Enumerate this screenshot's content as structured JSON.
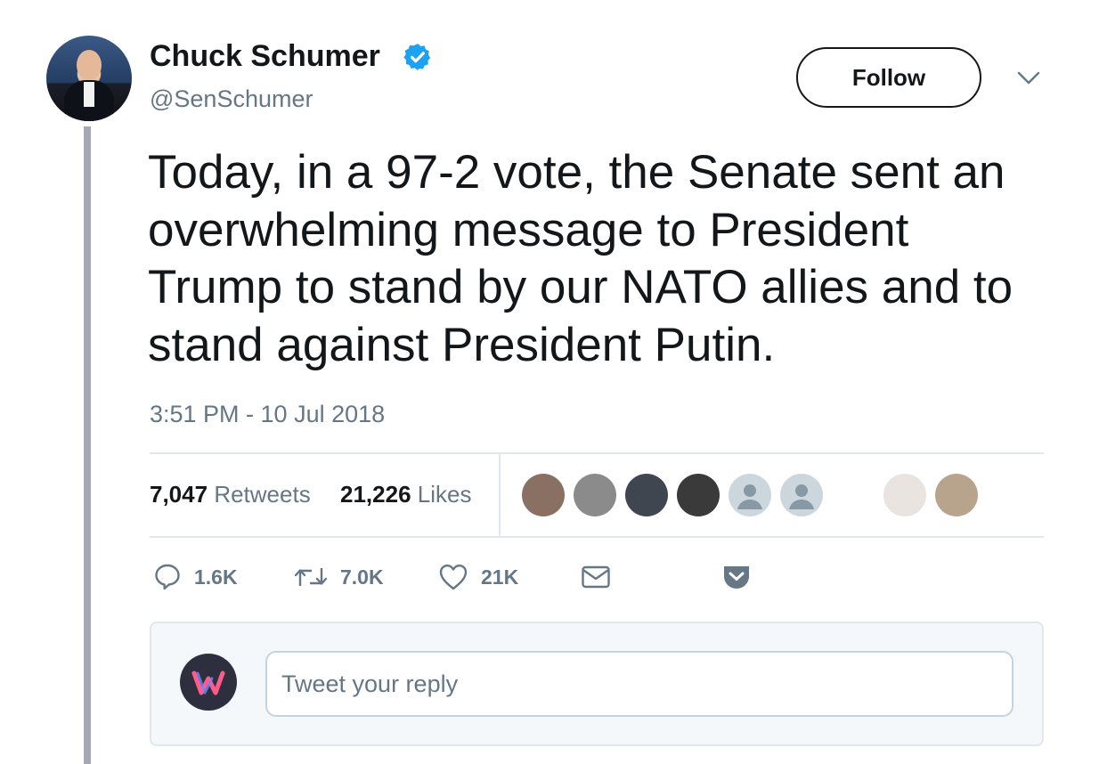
{
  "author": {
    "name": "Chuck Schumer",
    "handle": "@SenSchumer",
    "verified_icon": "verified-badge-icon",
    "avatar_icon": "profile-photo"
  },
  "header": {
    "follow_label": "Follow",
    "more_icon": "chevron-down-icon"
  },
  "tweet": {
    "text": "Today, in a 97-2 vote, the Senate sent an overwhelming message to President Trump to stand by our NATO allies and to stand against President Putin.",
    "timestamp": "3:51 PM - 10 Jul 2018"
  },
  "stats": {
    "retweets_count": "7,047",
    "retweets_label": "Retweets",
    "likes_count": "21,226",
    "likes_label": "Likes",
    "likers": [
      {
        "name": "liker-avatar-1",
        "color": "#8a6f63"
      },
      {
        "name": "liker-avatar-2",
        "color": "#8b8b8b"
      },
      {
        "name": "liker-avatar-3",
        "color": "#3f4650"
      },
      {
        "name": "liker-avatar-4",
        "color": "#3a3a3a"
      },
      {
        "name": "liker-avatar-5-default",
        "color": "#ccd6dd"
      },
      {
        "name": "liker-avatar-6-default",
        "color": "#ccd6dd"
      },
      {
        "name": "liker-avatar-7",
        "color": "#ffffff"
      },
      {
        "name": "liker-avatar-8",
        "color": "#e9e4e0"
      },
      {
        "name": "liker-avatar-9",
        "color": "#b8a48c"
      }
    ]
  },
  "actions": {
    "reply_count": "1.6K",
    "retweet_count": "7.0K",
    "like_count": "21K"
  },
  "reply": {
    "placeholder": "Tweet your reply"
  },
  "colors": {
    "accent_blue": "#1da1f2",
    "text_primary": "#14171a",
    "text_secondary": "#657786",
    "thread_line": "#a8a7b5",
    "pocket": "#667786"
  }
}
